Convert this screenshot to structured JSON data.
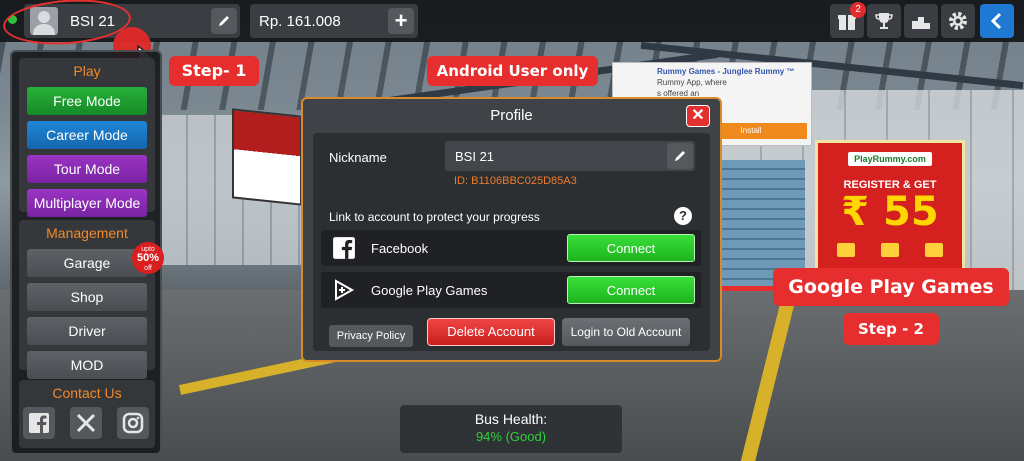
{
  "topbar": {
    "player_name": "BSI 21",
    "money": "Rp. 161.008",
    "add_label": "+",
    "notification_count": "2"
  },
  "annotations": {
    "step1": "Step- 1",
    "android_only": "Android User only",
    "google_play_callout": "Google Play Games",
    "step2": "Step - 2"
  },
  "menu": {
    "play_heading": "Play",
    "play_items": [
      "Free Mode",
      "Career Mode",
      "Tour Mode",
      "Multiplayer Mode"
    ],
    "management_heading": "Management",
    "management_items": [
      "Garage",
      "Shop",
      "Driver",
      "MOD"
    ],
    "sale_badge": {
      "top": "upto",
      "big": "50%",
      "bottom": "off"
    },
    "contact_heading": "Contact Us"
  },
  "profile": {
    "title": "Profile",
    "close_label": "✕",
    "nickname_label": "Nickname",
    "nickname_value": "BSI 21",
    "player_id": "ID: B1106BBC025D85A3",
    "link_prompt": "Link to account to protect your progress",
    "help_label": "?",
    "accounts": [
      {
        "name": "Facebook",
        "button": "Connect"
      },
      {
        "name": "Google Play Games",
        "button": "Connect"
      }
    ],
    "privacy_label": "Privacy Policy",
    "delete_label": "Delete Account",
    "old_account_label": "Login to Old Account"
  },
  "bus_health": {
    "label": "Bus Health:",
    "value": "94% (Good)"
  },
  "ads": {
    "top_title": "Rummy Games - Junglee Rummy ™",
    "top_lines": [
      "Rummy App, where",
      "s offered an"
    ],
    "top_button": "Install",
    "brand": "PlayRummy.com",
    "headline": "REGISTER & GET",
    "amount": "₹ 55"
  },
  "colors": {
    "accent_orange": "#f08a2a",
    "connect_green": "#2bd02c",
    "delete_red": "#e03232",
    "annotation_red": "#e62e2e"
  }
}
